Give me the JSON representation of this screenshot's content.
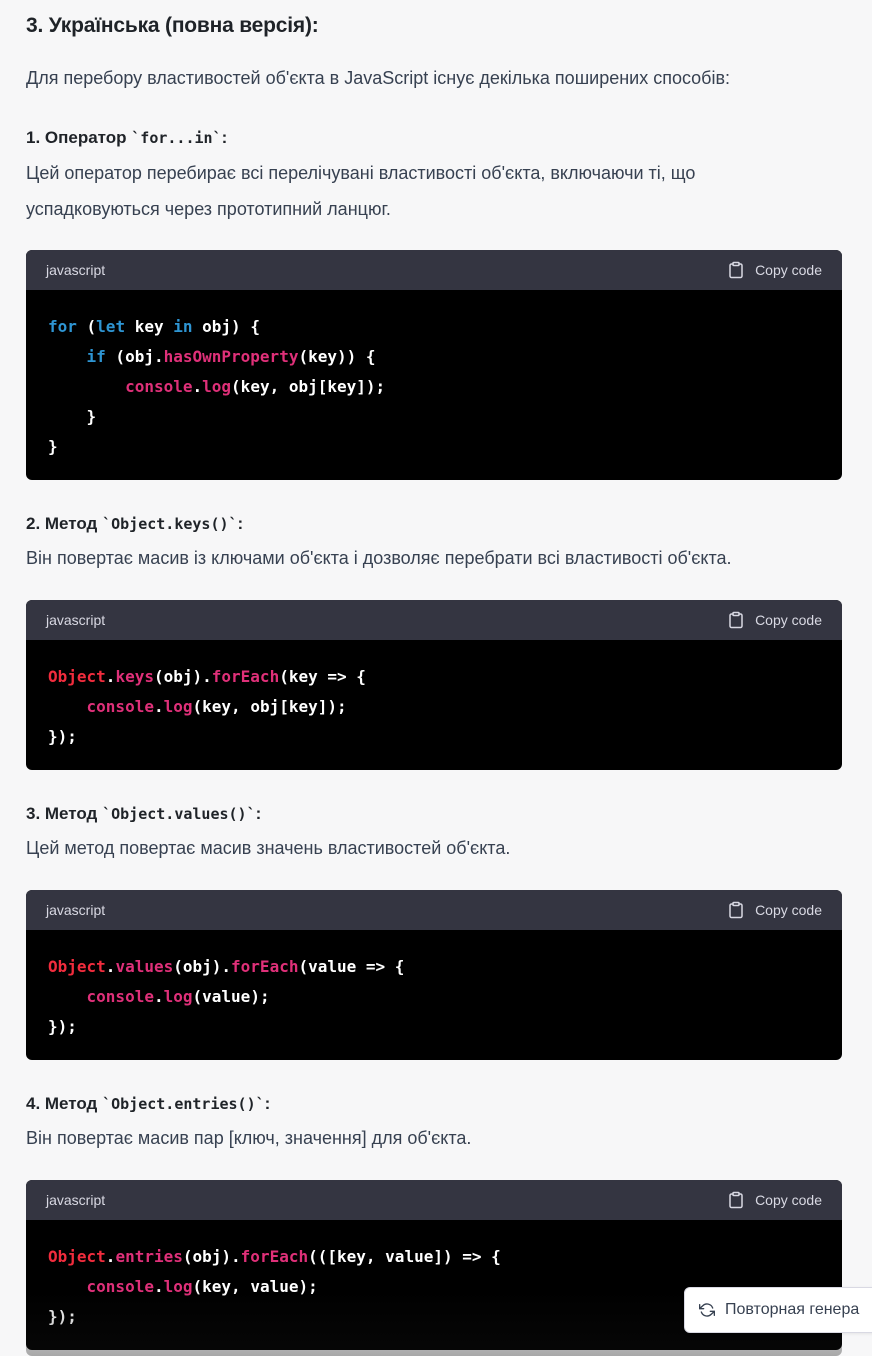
{
  "heading": "3. Українська (повна версія):",
  "intro": "Для перебору властивостей об'єкта в JavaScript існує декілька поширених способів:",
  "sections": [
    {
      "number_label": "1. Оператор ",
      "code_label": "`for...in`",
      "colon": ":",
      "description_line1": "Цей оператор перебирає всі перелічувані властивості об'єкта, включаючи ті, що",
      "description_line2": "успадковуються через прототипний ланцюг.",
      "lang": "javascript",
      "copy_label": "Copy code"
    },
    {
      "number_label": "2. Метод ",
      "code_label": "`Object.keys()`",
      "colon": ":",
      "description_line1": "Він повертає масив із ключами об'єкта і дозволяє перебрати всі властивості об'єкта.",
      "lang": "javascript",
      "copy_label": "Copy code"
    },
    {
      "number_label": "3. Метод ",
      "code_label": "`Object.values()`",
      "colon": ":",
      "description_line1": "Цей метод повертає масив значень властивостей об'єкта.",
      "lang": "javascript",
      "copy_label": "Copy code"
    },
    {
      "number_label": "4. Метод ",
      "code_label": "`Object.entries()`",
      "colon": ":",
      "description_line1": "Він повертає масив пар [ключ, значення] для об'єкта.",
      "lang": "javascript",
      "copy_label": "Copy code"
    }
  ],
  "code": {
    "c1": {
      "l1_for": "for",
      "l1_a": " (",
      "l1_let": "let",
      "l1_b": " key ",
      "l1_in": "in",
      "l1_c": " obj) {",
      "l2_indent": "    ",
      "l2_if": "if",
      "l2_a": " (obj.",
      "l2_fn": "hasOwnProperty",
      "l2_b": "(key)) {",
      "l3_indent": "        ",
      "l3_console": "console",
      "l3_dot": ".",
      "l3_log": "log",
      "l3_rest": "(key, obj[key]);",
      "l4": "    }",
      "l5": "}"
    },
    "c2": {
      "l1_obj": "Object",
      "l1_dot": ".",
      "l1_keys": "keys",
      "l1_a": "(obj).",
      "l1_fe": "forEach",
      "l1_b": "(key => {",
      "l2_indent": "    ",
      "l2_console": "console",
      "l2_dot": ".",
      "l2_log": "log",
      "l2_rest": "(key, obj[key]);",
      "l3": "});"
    },
    "c3": {
      "l1_obj": "Object",
      "l1_dot": ".",
      "l1_values": "values",
      "l1_a": "(obj).",
      "l1_fe": "forEach",
      "l1_b": "(value => {",
      "l2_indent": "    ",
      "l2_console": "console",
      "l2_dot": ".",
      "l2_log": "log",
      "l2_rest": "(value);",
      "l3": "});"
    },
    "c4": {
      "l1_obj": "Object",
      "l1_dot": ".",
      "l1_entries": "entries",
      "l1_a": "(obj).",
      "l1_fe": "forEach",
      "l1_b": "(([key, value]) => {",
      "l2_indent": "    ",
      "l2_console": "console",
      "l2_dot": ".",
      "l2_log": "log",
      "l2_rest": "(key, value);",
      "l3": "});"
    }
  },
  "regenerate_label": "Повторная генера",
  "icons": {
    "copy": "clipboard-icon",
    "regenerate": "refresh-icon"
  },
  "colors": {
    "keyword": "#2e95d3",
    "function": "#df3079",
    "builtin": "#f22c3d",
    "code_bg": "#000000",
    "code_header_bg": "#343541"
  }
}
